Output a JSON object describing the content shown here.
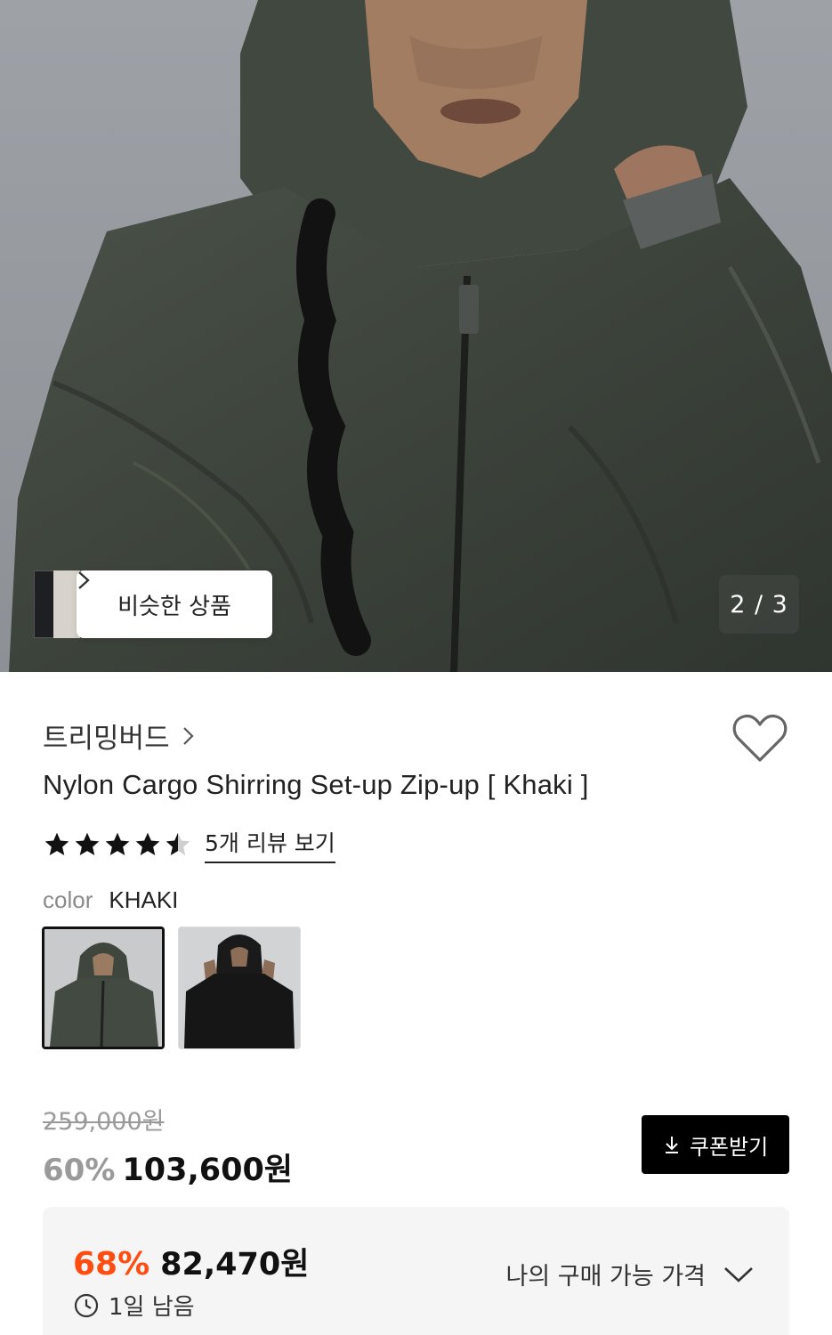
{
  "gallery": {
    "similar_label": "비슷한 상품",
    "page_indicator": "2 / 3"
  },
  "product": {
    "brand": "트리밍버드",
    "title": "Nylon Cargo Shirring Set-up Zip-up [ Khaki ]",
    "rating": 4.5,
    "review_link": "5개 리뷰 보기",
    "color_label": "color",
    "color_value": "KHAKI",
    "color_options": [
      "khaki",
      "black"
    ]
  },
  "pricing": {
    "original_price": "259,000원",
    "discount": "60%",
    "price": "103,600원",
    "coupon_label": "쿠폰받기"
  },
  "my_price": {
    "discount": "68%",
    "price": "82,470원",
    "remaining": "1일 남음",
    "toggle_label": "나의 구매 가능 가격"
  },
  "colors": {
    "accent": "#ff4d12",
    "coupon_bg": "#000000",
    "panel_bg": "#f5f5f5"
  }
}
